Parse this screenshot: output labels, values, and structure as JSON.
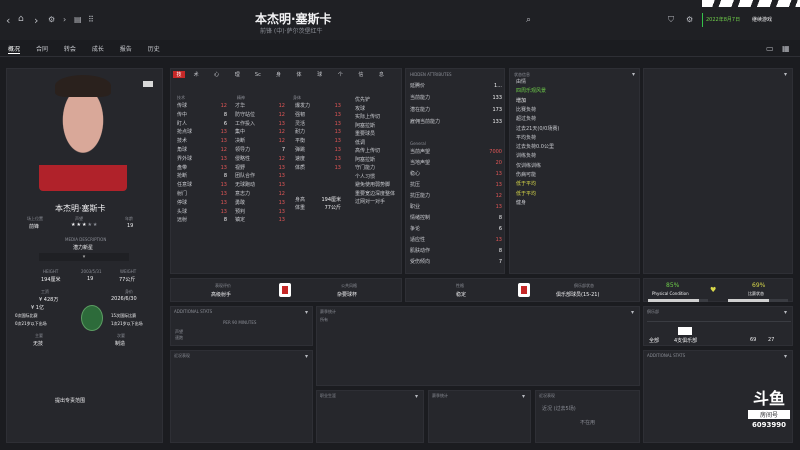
{
  "header": {
    "player_name": "本杰明·塞斯卡",
    "subtitle": "前锋 (中)·萨尔茨堡红牛",
    "date_text": "2022年8月7日",
    "continue_label": "继续游戏",
    "colors": {
      "date": "#35c24a"
    }
  },
  "nav": {
    "tabs": [
      "概况",
      "合同",
      "转会",
      "成长",
      "报告",
      "历史"
    ],
    "active": "概况"
  },
  "profile": {
    "name": "本杰明·塞斯卡",
    "position_label": "场上位置",
    "position_value": "前锋",
    "foot_label": "声望",
    "age_label": "年龄",
    "age_value": "19",
    "media_desc_label": "MEDIA DESCRIPTION",
    "media_desc_value": "潜力新星",
    "height_label": "HEIGHT",
    "height_value": "194厘米",
    "dob_value": "2003/5/31",
    "weight_label": "WEIGHT",
    "weight_value": "77公斤",
    "wage_label": "工资",
    "wage_value": "¥ 428万",
    "value_label": "身价",
    "value_value": "¥ 1亿",
    "contract_value": "2026/6/30",
    "intl_caps": "0次国际比赛",
    "intl_goals": "15次国际比赛",
    "club_caps": "0次21岁以下出场",
    "u21_caps": "1次21岁以下出场",
    "role_label": "主要",
    "role_value": "无技",
    "other_label": "次要",
    "other_value": "制造",
    "button_label": "提出专责范围"
  },
  "attributes": {
    "tabs": [
      "技",
      "术",
      "心",
      "理",
      "Sc",
      "身",
      "体",
      "球",
      "个",
      "信",
      "息"
    ],
    "col1_title": "技术",
    "col2_title": "精神",
    "col3_title": "身体",
    "technical": [
      {
        "name": "传球",
        "value": "12"
      },
      {
        "name": "传中",
        "value": "8"
      },
      {
        "name": "盯人",
        "value": "6"
      },
      {
        "name": "抢点球",
        "value": "13"
      },
      {
        "name": "技术",
        "value": "13"
      },
      {
        "name": "角球",
        "value": "12"
      },
      {
        "name": "界外球",
        "value": "13"
      },
      {
        "name": "盘带",
        "value": "13"
      },
      {
        "name": "抢断",
        "value": "8"
      },
      {
        "name": "任意球",
        "value": "13"
      },
      {
        "name": "射门",
        "value": "13"
      },
      {
        "name": "停球",
        "value": "13"
      },
      {
        "name": "头球",
        "value": "13"
      },
      {
        "name": "远射",
        "value": "8"
      }
    ],
    "mental": [
      {
        "name": "才华",
        "value": "12"
      },
      {
        "name": "防守站位",
        "value": "12"
      },
      {
        "name": "工作投入",
        "value": "13"
      },
      {
        "name": "集中",
        "value": "12"
      },
      {
        "name": "决断",
        "value": "12"
      },
      {
        "name": "领导力",
        "value": "7"
      },
      {
        "name": "侵略性",
        "value": "12"
      },
      {
        "name": "视野",
        "value": "13"
      },
      {
        "name": "团队合作",
        "value": "13"
      },
      {
        "name": "无球跑动",
        "value": "13"
      },
      {
        "name": "意志力",
        "value": "12"
      },
      {
        "name": "勇敢",
        "value": "13"
      },
      {
        "name": "预判",
        "value": "13"
      },
      {
        "name": "镇定",
        "value": "13"
      }
    ],
    "physical": [
      {
        "name": "爆发力",
        "value": "13"
      },
      {
        "name": "强韧",
        "value": "13"
      },
      {
        "name": "灵活",
        "value": "13"
      },
      {
        "name": "耐力",
        "value": "13"
      },
      {
        "name": "平衡",
        "value": "13"
      },
      {
        "name": "弹跳",
        "value": "13"
      },
      {
        "name": "速度",
        "value": "13"
      },
      {
        "name": "体质",
        "value": "13"
      }
    ],
    "height_row": {
      "label": "身高",
      "value": "194厘米"
    },
    "weight_row": {
      "label": "体重",
      "value": "77公斤"
    }
  },
  "traits": {
    "items": [
      "优先铲",
      "攻球",
      "实际上传切",
      "阿塞拉斯",
      "重要球员",
      "低调",
      "高传上传切",
      "阿塞拉斯",
      "守门能力",
      "个人习惯",
      "避免使用弱势脚",
      "重要宽边深度整体",
      "过网对一对手"
    ]
  },
  "hidden": {
    "title": "HIDDEN ATTRIBUTES",
    "items": [
      {
        "label": "延腾价",
        "value": "1..."
      },
      {
        "label": "当前能力",
        "value": "133"
      },
      {
        "label": "潜在能力",
        "value": "173"
      },
      {
        "label": "雇佣当前能力",
        "value": "133"
      }
    ],
    "general_title": "General",
    "general": [
      {
        "label": "当前声望",
        "value": "7000"
      },
      {
        "label": "当地声望",
        "value": "20"
      },
      {
        "label": "稳心",
        "value": "13"
      },
      {
        "label": "抗压",
        "value": "13"
      },
      {
        "label": "抗压能力",
        "value": "12"
      },
      {
        "label": "职业",
        "value": "13"
      },
      {
        "label": "情绪控制",
        "value": "8"
      },
      {
        "label": "争论",
        "value": "6"
      },
      {
        "label": "适应性",
        "value": "13"
      },
      {
        "label": "肌肤动作",
        "value": "8"
      },
      {
        "label": "受伤倾向",
        "value": "7"
      }
    ]
  },
  "status": {
    "title": "状态信息",
    "items": [
      "由情",
      "四周乐观风景",
      "增加",
      "比赛负荷",
      "超过负荷",
      "过去21天(0/0场赛)",
      "平均负荷",
      "过去负荷0.0公里",
      "训练负荷",
      "仅训练训练",
      "伤病可能",
      "低于平均",
      "低于平均",
      "健身"
    ]
  },
  "perf": {
    "title": "表现评价",
    "rating_label": "表现评价",
    "rating_value": "高级射手",
    "style_label": "公共风格",
    "style_value": "杂要球杯",
    "fit_label": "性格",
    "fit_value": "稳定",
    "club_label": "俱乐部状态",
    "club_value": "俱乐部球员(15-21)"
  },
  "fitness": {
    "physical_pct": "85%",
    "physical_label": "Physical Condition",
    "sharpness_pct": "69%",
    "sharpness_label": "比赛状态",
    "physical_fill": 0.85,
    "sharpness_fill": 0.69
  },
  "sections": {
    "additional": "ADDITIONAL STATS",
    "per90": "PER 90 MINUTES",
    "season": "赛季统计",
    "recent": "近况表现",
    "career": "职业生涯",
    "dunno": "不在用",
    "club_label": "俱乐部",
    "club_row": "全部",
    "club_row2": "4支俱乐部",
    "club_n1": "69",
    "club_n2": "27",
    "recent_sub": "近况 (过去5场)"
  },
  "watermark": {
    "brand": "斗鱼",
    "room_label": "房间号",
    "room_id": "6093990"
  }
}
